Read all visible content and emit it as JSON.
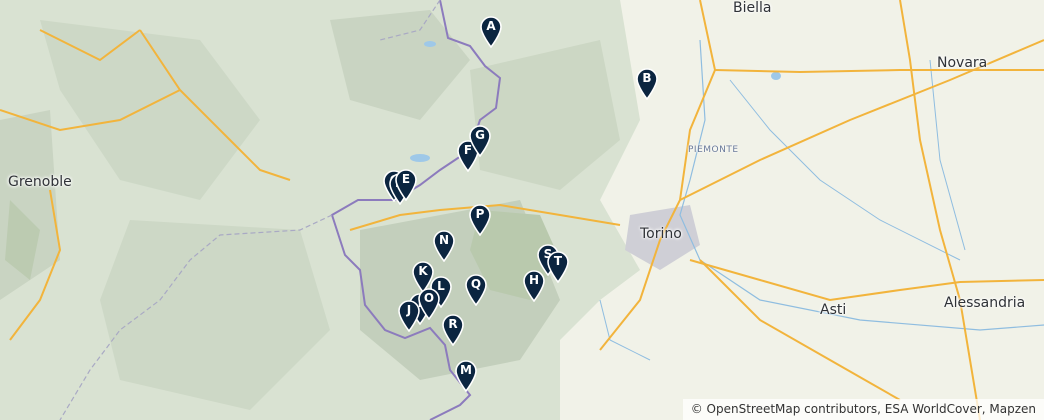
{
  "map": {
    "cities": {
      "biella": "Biella",
      "novara": "Novara",
      "grenoble": "Grenoble",
      "torino": "Torino",
      "asti": "Asti",
      "alessandria": "Alessandria"
    },
    "region": "PIEMONTE",
    "markers": [
      "A",
      "B",
      "C",
      "D",
      "E",
      "F",
      "G",
      "H",
      "I",
      "J",
      "K",
      "L",
      "M",
      "N",
      "O",
      "P",
      "Q",
      "R",
      "S",
      "T"
    ],
    "marker_color": "#0b2540",
    "attribution": {
      "copyright": "©",
      "osm": "OpenStreetMap contributors",
      "rest": ", ESA WorldCover, Mapzen"
    }
  }
}
